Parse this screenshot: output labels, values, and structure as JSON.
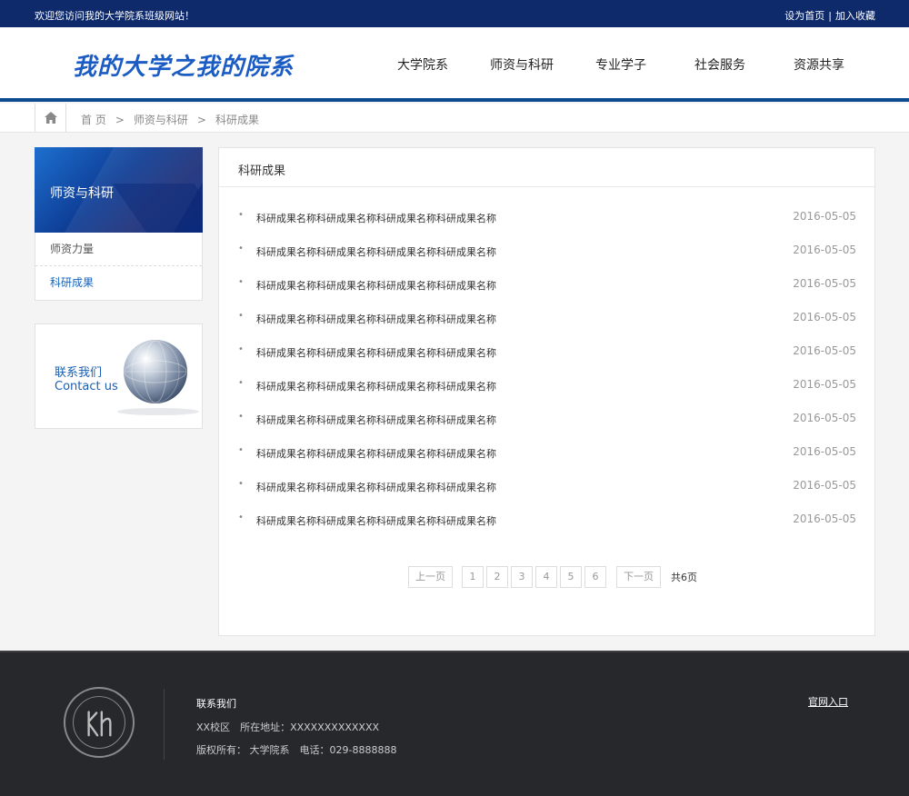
{
  "topbar": {
    "welcome": "欢迎您访问我的大学院系班级网站！",
    "set_home": "设为首页",
    "separator": "|",
    "bookmark": "加入收藏"
  },
  "header": {
    "logo_text": "我的大学之我的院系",
    "nav": [
      "大学院系",
      "师资与科研",
      "专业学子",
      "社会服务",
      "资源共享"
    ]
  },
  "breadcrumb": {
    "home": "首 页",
    "sep": ">",
    "level1": "师资与科研",
    "level2": "科研成果"
  },
  "sidebar": {
    "title": "师资与科研",
    "items": [
      {
        "label": "师资力量",
        "active": false
      },
      {
        "label": "科研成果",
        "active": true
      }
    ],
    "contact_cn": "联系我们",
    "contact_en": "Contact us"
  },
  "main": {
    "title": "科研成果",
    "items": [
      {
        "title": "科研成果名称科研成果名称科研成果名称科研成果名称",
        "date": "2016-05-05"
      },
      {
        "title": "科研成果名称科研成果名称科研成果名称科研成果名称",
        "date": "2016-05-05"
      },
      {
        "title": "科研成果名称科研成果名称科研成果名称科研成果名称",
        "date": "2016-05-05"
      },
      {
        "title": "科研成果名称科研成果名称科研成果名称科研成果名称",
        "date": "2016-05-05"
      },
      {
        "title": "科研成果名称科研成果名称科研成果名称科研成果名称",
        "date": "2016-05-05"
      },
      {
        "title": "科研成果名称科研成果名称科研成果名称科研成果名称",
        "date": "2016-05-05"
      },
      {
        "title": "科研成果名称科研成果名称科研成果名称科研成果名称",
        "date": "2016-05-05"
      },
      {
        "title": "科研成果名称科研成果名称科研成果名称科研成果名称",
        "date": "2016-05-05"
      },
      {
        "title": "科研成果名称科研成果名称科研成果名称科研成果名称",
        "date": "2016-05-05"
      },
      {
        "title": "科研成果名称科研成果名称科研成果名称科研成果名称",
        "date": "2016-05-05"
      }
    ]
  },
  "pagination": {
    "prev": "上一页",
    "pages": [
      "1",
      "2",
      "3",
      "4",
      "5",
      "6"
    ],
    "next": "下一页",
    "total": "共6页"
  },
  "footer": {
    "contact_title": "联系我们",
    "address": "XX校区　所在地址：XXXXXXXXXXXXX",
    "copyright": "版权所有： 大学院系　电话：029-8888888",
    "official_link": "官网入口"
  },
  "colors": {
    "topbar": "#0e2a6b",
    "accent": "#0e4a8f",
    "link_active": "#1565c0",
    "footer": "#26282c"
  }
}
